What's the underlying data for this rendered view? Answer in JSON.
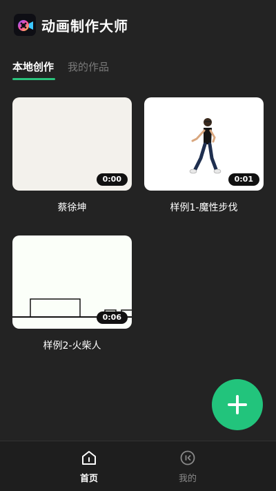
{
  "app": {
    "title": "动画制作大师"
  },
  "tabs": [
    {
      "label": "本地创作"
    },
    {
      "label": "我的作品"
    }
  ],
  "works": [
    {
      "title": "蔡徐坤",
      "duration": "0:00"
    },
    {
      "title": "样例1-魔性步伐",
      "duration": "0:01"
    },
    {
      "title": "样例2-火柴人",
      "duration": "0:06"
    }
  ],
  "fab": {
    "icon": "plus-icon"
  },
  "bottom_nav": [
    {
      "label": "首页",
      "icon": "home-icon"
    },
    {
      "label": "我的",
      "icon": "profile-icon"
    }
  ],
  "colors": {
    "accent": "#22c47c",
    "background": "#232323",
    "inactive": "#7a7a7a"
  }
}
